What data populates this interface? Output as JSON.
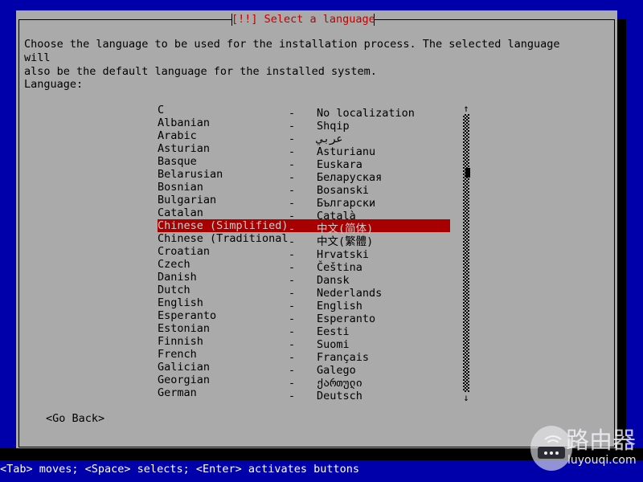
{
  "window": {
    "title": "[!!] Select a language",
    "intro": "Choose the language to be used for the installation process. The selected language will\nalso be the default language for the installed system.",
    "language_label": "Language:"
  },
  "list": {
    "selected_index": 9,
    "dash": "-",
    "rows": [
      {
        "english": "C",
        "native": "No localization"
      },
      {
        "english": "Albanian",
        "native": "Shqip"
      },
      {
        "english": "Arabic",
        "native": "عربي"
      },
      {
        "english": "Asturian",
        "native": "Asturianu"
      },
      {
        "english": "Basque",
        "native": "Euskara"
      },
      {
        "english": "Belarusian",
        "native": "Беларуская"
      },
      {
        "english": "Bosnian",
        "native": "Bosanski"
      },
      {
        "english": "Bulgarian",
        "native": "Български"
      },
      {
        "english": "Catalan",
        "native": "Català"
      },
      {
        "english": "Chinese (Simplified)",
        "native": "中文(简体)"
      },
      {
        "english": "Chinese (Traditional)",
        "native": "中文(繁體)"
      },
      {
        "english": "Croatian",
        "native": "Hrvatski"
      },
      {
        "english": "Czech",
        "native": "Čeština"
      },
      {
        "english": "Danish",
        "native": "Dansk"
      },
      {
        "english": "Dutch",
        "native": "Nederlands"
      },
      {
        "english": "English",
        "native": "English"
      },
      {
        "english": "Esperanto",
        "native": "Esperanto"
      },
      {
        "english": "Estonian",
        "native": "Eesti"
      },
      {
        "english": "Finnish",
        "native": "Suomi"
      },
      {
        "english": "French",
        "native": "Français"
      },
      {
        "english": "Galician",
        "native": "Galego"
      },
      {
        "english": "Georgian",
        "native": "ქართული"
      },
      {
        "english": "German",
        "native": "Deutsch"
      }
    ]
  },
  "scrollbar": {
    "up_arrow": "↑",
    "down_arrow": "↓"
  },
  "buttons": {
    "go_back": "<Go Back>"
  },
  "statusbar": {
    "text": "<Tab> moves; <Space> selects; <Enter> activates buttons"
  },
  "watermark": {
    "chinese": "路由器",
    "url": "luyouqi.com"
  },
  "colors": {
    "desktop_blue": "#0000aa",
    "panel_gray": "#aaaaaa",
    "title_red": "#c00000",
    "highlight_red": "#a80000",
    "highlight_text": "#cccccc",
    "text_black": "#000000",
    "status_text": "#ffffff"
  }
}
